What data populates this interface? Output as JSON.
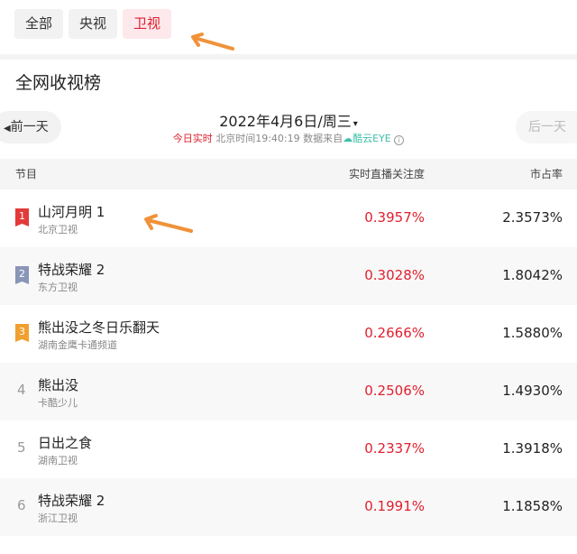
{
  "tabs": [
    {
      "label": "全部",
      "active": false
    },
    {
      "label": "央视",
      "active": false
    },
    {
      "label": "卫视",
      "active": true
    }
  ],
  "section_title": "全网收视榜",
  "nav": {
    "prev": "前一天",
    "next": "后一天"
  },
  "date": {
    "text": "2022年4月6日/周三",
    "caret": "▾"
  },
  "status": {
    "live": "今日实时",
    "time": "北京时间19:40:19",
    "source": "数据来自",
    "brand": "酷云EYE",
    "info_icon": "i"
  },
  "table": {
    "headers": {
      "program": "节目",
      "attention": "实时直播关注度",
      "share": "市占率"
    },
    "rows": [
      {
        "rank": "1",
        "title": "山河月明 1",
        "channel": "北京卫视",
        "attention": "0.3957%",
        "share": "2.3573%"
      },
      {
        "rank": "2",
        "title": "特战荣耀 2",
        "channel": "东方卫视",
        "attention": "0.3028%",
        "share": "1.8042%"
      },
      {
        "rank": "3",
        "title": "熊出没之冬日乐翻天",
        "channel": "湖南金鹰卡通频道",
        "attention": "0.2666%",
        "share": "1.5880%"
      },
      {
        "rank": "4",
        "title": "熊出没",
        "channel": "卡酷少儿",
        "attention": "0.2506%",
        "share": "1.4930%"
      },
      {
        "rank": "5",
        "title": "日出之食",
        "channel": "湖南卫视",
        "attention": "0.2337%",
        "share": "1.3918%"
      },
      {
        "rank": "6",
        "title": "特战荣耀 2",
        "channel": "浙江卫视",
        "attention": "0.1991%",
        "share": "1.1858%"
      }
    ]
  },
  "colors": {
    "accent": "#e0202e",
    "rank1": "#e23a3a",
    "rank2": "#8a96b8",
    "rank3": "#f0a030",
    "arrow": "#f0923a"
  }
}
